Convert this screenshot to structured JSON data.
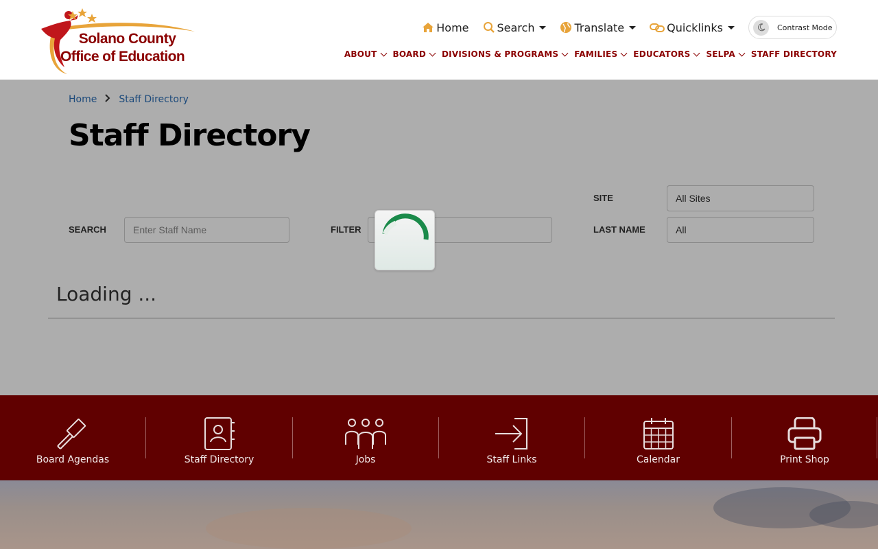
{
  "logo": {
    "line1": "Solano County",
    "line2": "Office of Education"
  },
  "utility_nav": {
    "home": "Home",
    "search": "Search",
    "translate": "Translate",
    "quicklinks": "Quicklinks",
    "contrast": "Contrast Mode"
  },
  "main_nav": [
    {
      "label": "ABOUT"
    },
    {
      "label": "BOARD"
    },
    {
      "label": "DIVISIONS & PROGRAMS"
    },
    {
      "label": "FAMILIES"
    },
    {
      "label": "EDUCATORS"
    },
    {
      "label": "SELPA"
    },
    {
      "label": "STAFF DIRECTORY"
    }
  ],
  "breadcrumb": {
    "home": "Home",
    "current": "Staff Directory"
  },
  "page_title": "Staff Directory",
  "filters": {
    "search_label": "SEARCH",
    "search_placeholder": "Enter Staff Name",
    "filter_label": "FILTER",
    "site_label": "SITE",
    "site_value": "All Sites",
    "lastname_label": "LAST NAME",
    "lastname_value": "All"
  },
  "loading_text": "Loading ...",
  "quickbar": [
    {
      "label": "Board Agendas",
      "icon": "gavel-icon"
    },
    {
      "label": "Staff Directory",
      "icon": "contact-book-icon"
    },
    {
      "label": "Jobs",
      "icon": "people-group-icon"
    },
    {
      "label": "Staff Links",
      "icon": "sign-in-arrow-icon"
    },
    {
      "label": "Calendar",
      "icon": "calendar-icon"
    },
    {
      "label": "Print Shop",
      "icon": "printer-icon"
    }
  ],
  "colors": {
    "brand": "#8b0000",
    "quickbar": "#600000",
    "link": "#2a6db5",
    "accent_gold": "#e8a43a",
    "spinner": "#1a8a4a"
  }
}
